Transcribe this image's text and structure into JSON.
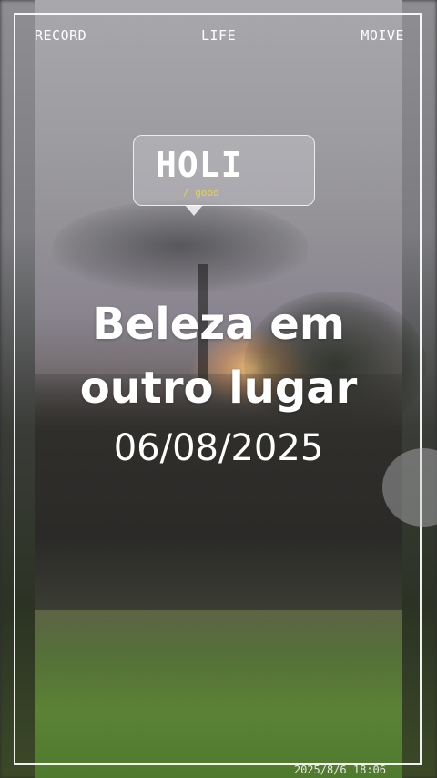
{
  "top_bar": {
    "record_label": "RECORD",
    "life_label": "LIFE",
    "moive_label": "MOIVE"
  },
  "bubble": {
    "title": "HOLI",
    "subtitle": "/ good"
  },
  "headline": {
    "line1": "Beleza em",
    "line2": "outro lugar",
    "date": "06/08/2025"
  },
  "timestamp": "2025/8/6 18:06",
  "colors": {
    "frame": "#ffffff",
    "text": "#ffffff",
    "bubble_subtitle": "#e8d24a"
  }
}
